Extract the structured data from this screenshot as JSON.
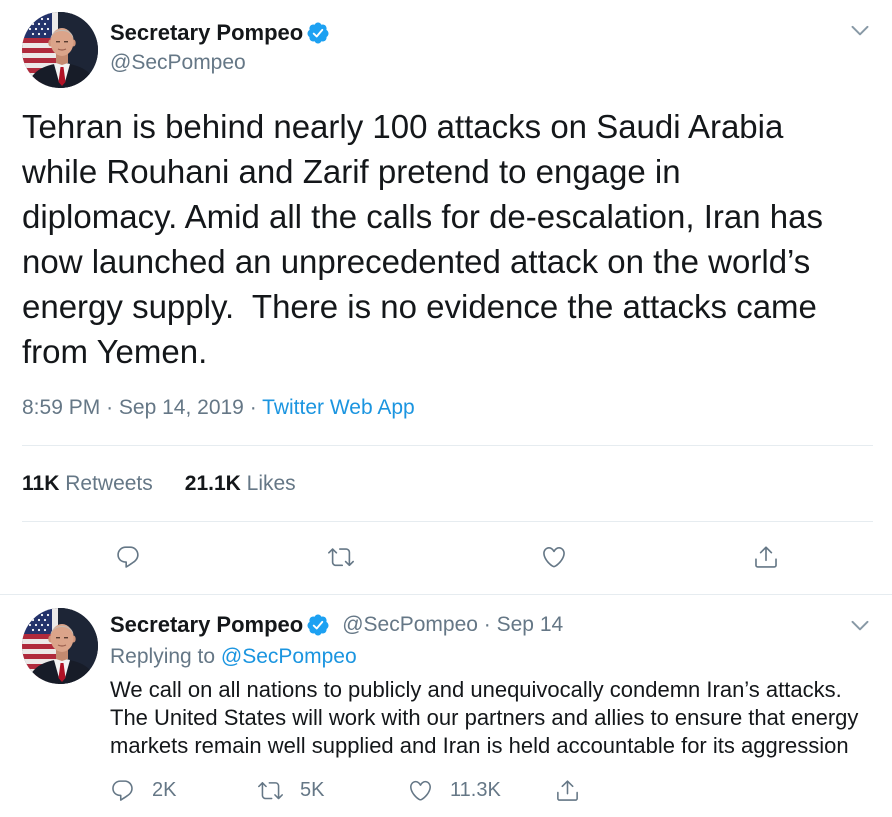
{
  "main_tweet": {
    "author": {
      "name": "Secretary Pompeo",
      "handle": "@SecPompeo",
      "verified": true
    },
    "text_lines": [
      "Tehran is behind nearly 100 attacks on Saudi Arabia",
      "while Rouhani and Zarif pretend to engage in",
      "diplomacy. Amid all the calls for de-escalation, Iran has",
      "now launched an unprecedented attack on the world’s",
      "energy supply.  There is no evidence the attacks came",
      "from Yemen."
    ],
    "meta": {
      "time": "8:59 PM",
      "separator": "·",
      "date": "Sep 14, 2019",
      "source": "Twitter Web App"
    },
    "stats": {
      "retweets": {
        "count": "11K",
        "label": "Retweets"
      },
      "likes": {
        "count": "21.1K",
        "label": "Likes"
      }
    },
    "actions": [
      {
        "icon": "reply-icon"
      },
      {
        "icon": "retweet-icon"
      },
      {
        "icon": "like-icon"
      },
      {
        "icon": "share-icon"
      }
    ]
  },
  "reply_tweet": {
    "author": {
      "name": "Secretary Pompeo",
      "handle": "@SecPompeo",
      "verified": true
    },
    "separator": "·",
    "date": "Sep 14",
    "replying_to": {
      "label": "Replying to",
      "handle": "@SecPompeo"
    },
    "text_lines": [
      "We call on all nations to publicly and unequivocally condemn Iran’s attacks.",
      "The United States will work with our partners and allies to ensure that energy",
      "markets remain well supplied and Iran is held accountable for its aggression"
    ],
    "actions": [
      {
        "icon": "reply-icon",
        "count": "2K"
      },
      {
        "icon": "retweet-icon",
        "count": "5K"
      },
      {
        "icon": "like-icon",
        "count": "11.3K"
      },
      {
        "icon": "share-icon"
      }
    ]
  },
  "menu_icon": "chevron-down-icon",
  "badge_icon": "verified-badge-icon",
  "colors": {
    "text": "#14171a",
    "secondary": "#657786",
    "link": "#1b95e0",
    "verified": "#1da1f2",
    "divider": "#e6ecf0"
  }
}
